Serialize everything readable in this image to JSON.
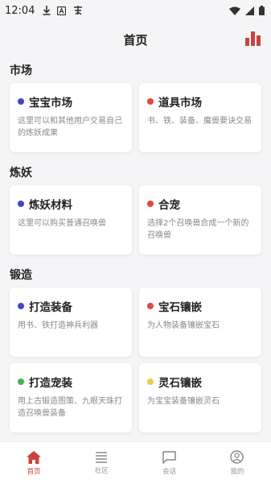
{
  "status": {
    "time": "12:04"
  },
  "header": {
    "title": "首页"
  },
  "sections": [
    {
      "title": "市场",
      "cards": [
        {
          "title": "宝宝市场",
          "desc": "这里可以和其他用户交易自己的炼妖成果",
          "color": "#3f48cc"
        },
        {
          "title": "道具市场",
          "desc": "书、铁、装备、魔兽要诀交易",
          "color": "#e04a3a"
        }
      ]
    },
    {
      "title": "炼妖",
      "cards": [
        {
          "title": "炼妖材料",
          "desc": "这里可以购买普通召唤兽",
          "color": "#3f48cc"
        },
        {
          "title": "合宠",
          "desc": "选择2个召唤兽合成一个新的召唤兽",
          "color": "#e04a3a"
        }
      ]
    },
    {
      "title": "锻造",
      "cards": [
        {
          "title": "打造装备",
          "desc": "用书、铁打造神兵利器",
          "color": "#3f48cc"
        },
        {
          "title": "宝石镶嵌",
          "desc": "为人物装备镶嵌宝石",
          "color": "#e04a3a"
        },
        {
          "title": "打造宠装",
          "desc": "用上古锻造图策、九眼天珠打造召唤兽装备",
          "color": "#4caf50"
        },
        {
          "title": "灵石镶嵌",
          "desc": "为宝宝装备镶嵌灵石",
          "color": "#f2c94c"
        }
      ]
    }
  ],
  "tabs": [
    {
      "label": "首页",
      "icon": "home-icon",
      "active": true
    },
    {
      "label": "社区",
      "icon": "list-icon",
      "active": false
    },
    {
      "label": "会话",
      "icon": "chat-icon",
      "active": false
    },
    {
      "label": "我的",
      "icon": "profile-icon",
      "active": false
    }
  ],
  "colors": {
    "accent": "#c9453c",
    "background": "#f5f5f7"
  }
}
